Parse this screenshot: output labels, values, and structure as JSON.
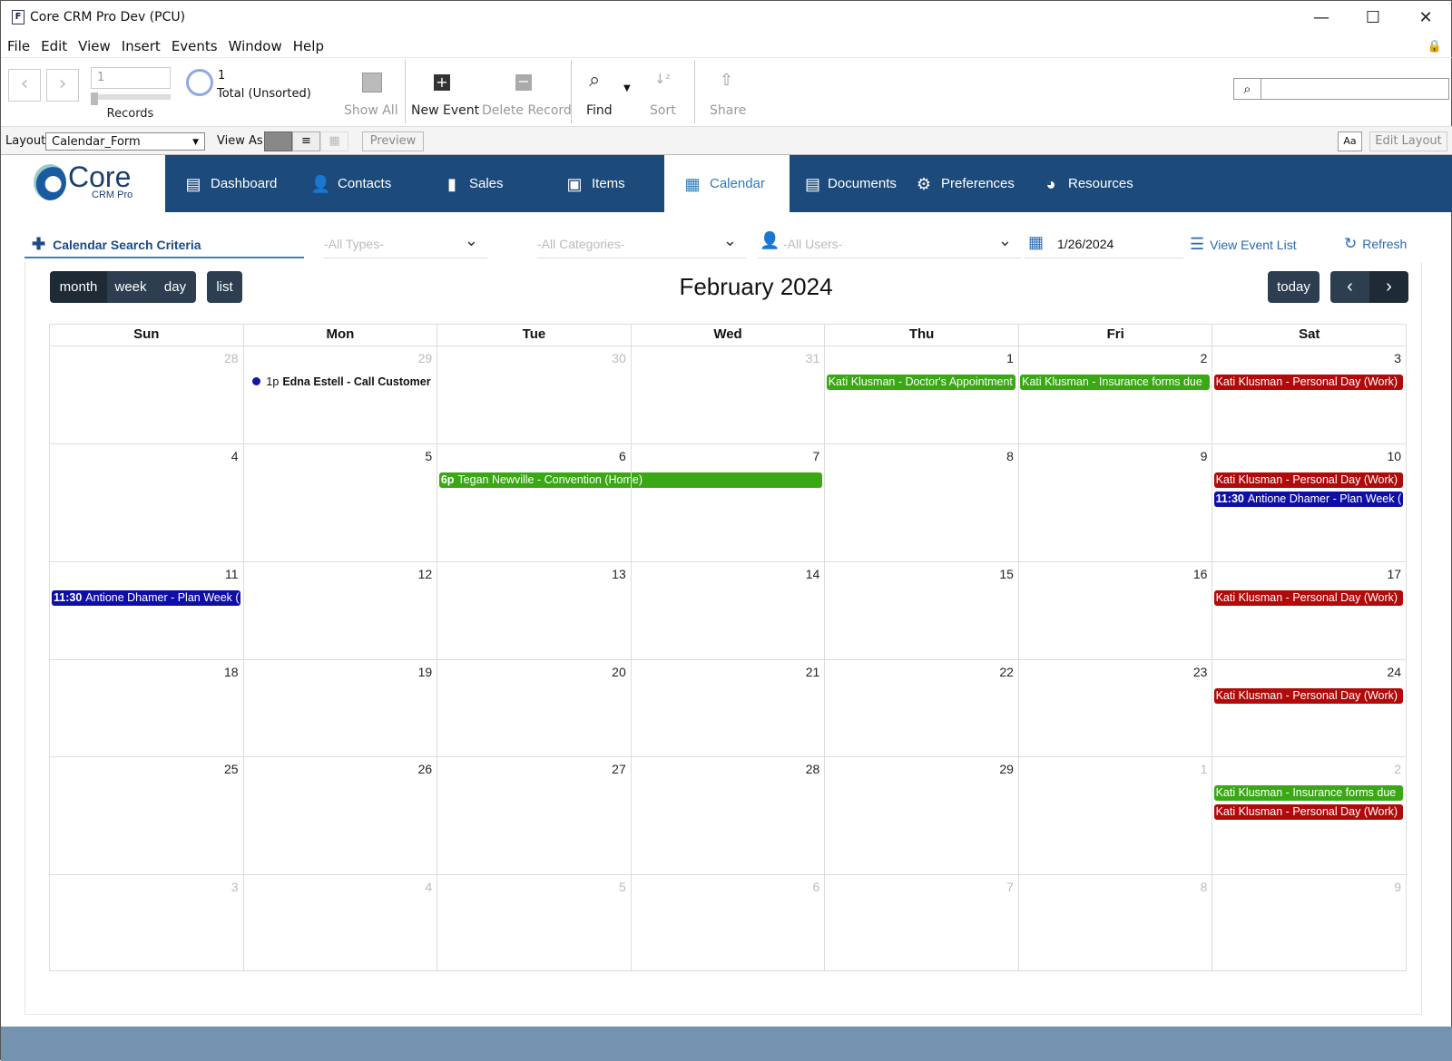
{
  "window": {
    "title": "Core CRM Pro Dev (PCU)",
    "app_icon": "F"
  },
  "menu": [
    "File",
    "Edit",
    "View",
    "Insert",
    "Events",
    "Window",
    "Help"
  ],
  "toolbar": {
    "record_value": "1",
    "records_label": "Records",
    "found_count": "1",
    "total_label": "Total (Unsorted)",
    "show_all": "Show All",
    "new_event": "New Event",
    "delete_record": "Delete Record",
    "find": "Find",
    "sort": "Sort",
    "share": "Share",
    "search_placeholder": ""
  },
  "layoutbar": {
    "layout_label": "Layout:",
    "layout_value": "Calendar_Form",
    "view_as": "View As:",
    "preview": "Preview",
    "aa": "Aa",
    "edit_layout": "Edit Layout"
  },
  "logo": {
    "name": "Core",
    "sub": "CRM Pro"
  },
  "nav": [
    {
      "label": "Dashboard",
      "icon": "dashboard-icon",
      "glyph": "▤"
    },
    {
      "label": "Contacts",
      "icon": "contact-icon",
      "glyph": "👤"
    },
    {
      "label": "Sales",
      "icon": "document-icon",
      "glyph": "▮"
    },
    {
      "label": "Items",
      "icon": "box-icon",
      "glyph": "▣"
    },
    {
      "label": "Calendar",
      "icon": "calendar-icon",
      "glyph": "▦",
      "active": true
    },
    {
      "label": "Documents",
      "icon": "documents-icon",
      "glyph": "▤"
    },
    {
      "label": "Preferences",
      "icon": "gear-icon",
      "glyph": "⚙"
    },
    {
      "label": "Resources",
      "icon": "globe-icon",
      "glyph": "◕"
    }
  ],
  "criteria": {
    "title": "Calendar Search Criteria",
    "types": "-All Types-",
    "categories": "-All Categories-",
    "users": "-All Users-",
    "date": "1/26/2024",
    "view_event_list": "View Event List",
    "refresh": "Refresh"
  },
  "calendar": {
    "title": "February 2024",
    "views": [
      "month",
      "week",
      "day"
    ],
    "active_view": "month",
    "list": "list",
    "today": "today",
    "weekdays": [
      "Sun",
      "Mon",
      "Tue",
      "Wed",
      "Thu",
      "Fri",
      "Sat"
    ],
    "colors": {
      "green": "#3aa815",
      "red": "#b00a0a",
      "blue": "#0f0fa8"
    },
    "weeks": [
      {
        "days": [
          {
            "n": "28",
            "other": true
          },
          {
            "n": "29",
            "other": true,
            "events": [
              {
                "style": "dot",
                "time": "1p",
                "title": "Edna Estell - Call Customer"
              }
            ]
          },
          {
            "n": "30",
            "other": true
          },
          {
            "n": "31",
            "other": true
          },
          {
            "n": "1",
            "events": [
              {
                "color": "green",
                "title": "Kati Klusman - Doctor's Appointment"
              }
            ]
          },
          {
            "n": "2",
            "events": [
              {
                "color": "green",
                "title": "Kati Klusman - Insurance forms due"
              }
            ]
          },
          {
            "n": "3",
            "events": [
              {
                "color": "red",
                "title": "Kati Klusman - Personal Day (Work)"
              }
            ]
          }
        ]
      },
      {
        "days": [
          {
            "n": "4"
          },
          {
            "n": "5"
          },
          {
            "n": "6",
            "events": [
              {
                "color": "green",
                "time": "6p",
                "title": "Tegan Newville - Convention (Home)",
                "span": 2
              }
            ]
          },
          {
            "n": "7"
          },
          {
            "n": "8"
          },
          {
            "n": "9"
          },
          {
            "n": "10",
            "events": [
              {
                "color": "red",
                "title": "Kati Klusman - Personal Day (Work)"
              },
              {
                "color": "blue",
                "time": "11:30",
                "title": "Antione Dhamer - Plan Week ("
              }
            ]
          }
        ]
      },
      {
        "days": [
          {
            "n": "11",
            "events": [
              {
                "color": "blue",
                "time": "11:30",
                "title": "Antione Dhamer - Plan Week ("
              }
            ]
          },
          {
            "n": "12"
          },
          {
            "n": "13"
          },
          {
            "n": "14"
          },
          {
            "n": "15"
          },
          {
            "n": "16"
          },
          {
            "n": "17",
            "events": [
              {
                "color": "red",
                "title": "Kati Klusman - Personal Day (Work)"
              }
            ]
          }
        ]
      },
      {
        "days": [
          {
            "n": "18"
          },
          {
            "n": "19"
          },
          {
            "n": "20"
          },
          {
            "n": "21"
          },
          {
            "n": "22"
          },
          {
            "n": "23"
          },
          {
            "n": "24",
            "events": [
              {
                "color": "red",
                "title": "Kati Klusman - Personal Day (Work)"
              }
            ]
          }
        ]
      },
      {
        "days": [
          {
            "n": "25"
          },
          {
            "n": "26"
          },
          {
            "n": "27"
          },
          {
            "n": "28"
          },
          {
            "n": "29"
          },
          {
            "n": "1",
            "other": true
          },
          {
            "n": "2",
            "other": true,
            "events": [
              {
                "color": "green",
                "title": "Kati Klusman - Insurance forms due"
              },
              {
                "color": "red",
                "title": "Kati Klusman - Personal Day (Work)"
              }
            ]
          }
        ]
      },
      {
        "days": [
          {
            "n": "3",
            "other": true
          },
          {
            "n": "4",
            "other": true
          },
          {
            "n": "5",
            "other": true
          },
          {
            "n": "6",
            "other": true
          },
          {
            "n": "7",
            "other": true
          },
          {
            "n": "8",
            "other": true
          },
          {
            "n": "9",
            "other": true
          }
        ]
      }
    ]
  }
}
